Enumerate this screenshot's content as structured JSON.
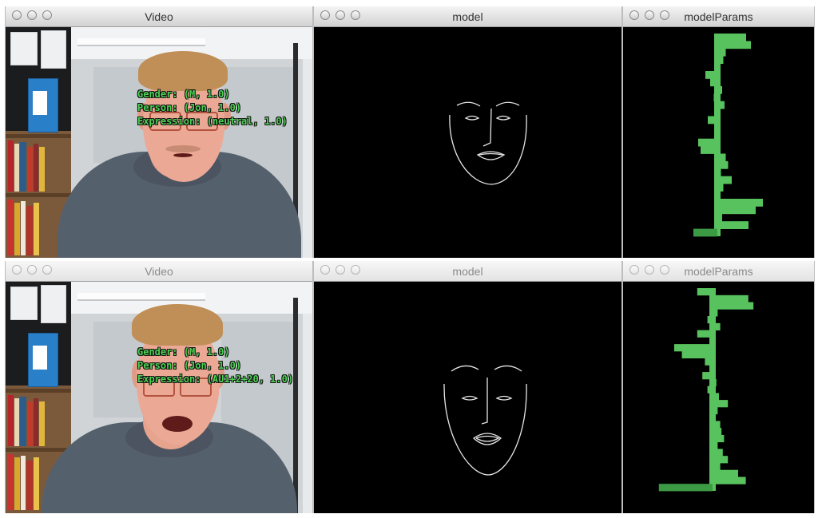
{
  "rows": [
    {
      "windows": {
        "video": {
          "title": "Video",
          "overlay": {
            "gender": "Gender: (M, 1.0)",
            "person": "Person: (Jon, 1.0)",
            "expression": "Expression: (neutral, 1.0)"
          }
        },
        "model": {
          "title": "model"
        },
        "params": {
          "title": "modelParams",
          "bars": [
            1.2,
            1.4,
            0.35,
            0.25,
            0.1,
            -0.5,
            -0.3,
            0.2,
            -0.15,
            0.3,
            0.0,
            -0.4,
            0.1,
            -0.1,
            -0.8,
            -0.7,
            0.35,
            0.45,
            0.15,
            0.6,
            0.25,
            0.1,
            1.9,
            1.6,
            0.2,
            1.3,
            -1.0
          ]
        }
      }
    },
    {
      "windows": {
        "video": {
          "title": "Video",
          "overlay": {
            "gender": "Gender: (M, 1.0)",
            "person": "Person: (Jon, 1.0)",
            "expression": "Expression: (AU1+2+20, 1.0)"
          }
        },
        "model": {
          "title": "model"
        },
        "params": {
          "title": "modelParams",
          "bars": [
            -0.6,
            1.4,
            1.6,
            0.2,
            -0.2,
            0.3,
            -0.6,
            0.05,
            -1.5,
            -1.2,
            -0.3,
            0.1,
            -0.4,
            0.15,
            -0.2,
            0.25,
            0.6,
            0.2,
            -0.1,
            0.3,
            0.35,
            0.45,
            0.2,
            0.4,
            0.6,
            0.3,
            1.0,
            1.3,
            -2.1
          ]
        }
      }
    }
  ],
  "colors": {
    "bar": "#58c35e",
    "bar_dark": "#3c9a44",
    "overlay_text": "#4cd254",
    "face_line": "#e6e6e6"
  }
}
